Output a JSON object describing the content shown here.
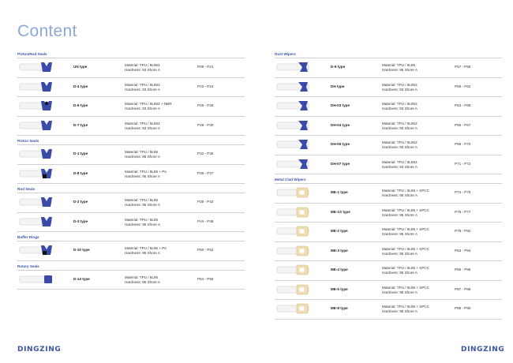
{
  "title": "Content",
  "logo": "DINGZING",
  "colors": {
    "accent": "#3b54a6",
    "title": "#8ea8d8",
    "seal_blue": "#3a4aa8",
    "metal": "#f1dfb2"
  },
  "left_column": [
    {
      "heading": "Piston/Rod Seals",
      "items": [
        {
          "icon": "un-type-seal-icon",
          "type": "UN type",
          "material": "Material: TPU / 8L953",
          "hardness": "Hardness: 93 Shore A",
          "pages": "P05 - P21"
        },
        {
          "icon": "d4-type-seal-icon",
          "type": "D-4 type",
          "material": "Material: TPU / 8L953",
          "hardness": "Hardness: 93 Shore A",
          "pages": "P22 - P24"
        },
        {
          "icon": "d6-type-seal-icon",
          "type": "D-6 type",
          "material": "Material: TPU / 8L953 + NBR",
          "hardness": "Hardness: 93 Shore A",
          "pages": "P25 - P28"
        },
        {
          "icon": "d7-type-seal-icon",
          "type": "D-7 type",
          "material": "Material: TPU / 8L953",
          "hardness": "Hardness: 93 Shore A",
          "pages": "P29 - P30"
        }
      ]
    },
    {
      "heading": "Piston Seals",
      "items": [
        {
          "icon": "d1-type-seal-icon",
          "type": "D-1 type",
          "material": "Material: TPU / 8L95",
          "hardness": "Hardness: 95 Shore A",
          "pages": "P32 - P35"
        },
        {
          "icon": "d8-type-seal-icon",
          "type": "D-8 type",
          "material": "Material: TPU / 8L95 + PA",
          "hardness": "Hardness: 95 Shore A",
          "pages": "P36 - P37"
        }
      ]
    },
    {
      "heading": "Rod Seals",
      "items": [
        {
          "icon": "d2-type-seal-icon",
          "type": "D-2 type",
          "material": "Material: TPU / 8L95",
          "hardness": "Hardness: 95 Shore A",
          "pages": "P39 - P43"
        },
        {
          "icon": "d3-type-seal-icon",
          "type": "D-3 type",
          "material": "Material: TPU / 8L95",
          "hardness": "Hardness: 95 Shore A",
          "pages": "P44 - P48"
        }
      ]
    },
    {
      "heading": "Buffer Rings",
      "items": [
        {
          "icon": "d10-type-seal-icon",
          "type": "D-10 type",
          "material": "Material: TPU / 8L95 + PA",
          "hardness": "Hardness: 95 Shore A",
          "pages": "P50 - P52"
        }
      ]
    },
    {
      "heading": "Rotary Seals",
      "items": [
        {
          "icon": "d14-type-seal-icon",
          "type": "D-14 type",
          "material": "Material: TPU / 8L95",
          "hardness": "Hardness: 95 Shore A",
          "pages": "P54 - P55"
        }
      ]
    }
  ],
  "right_column": [
    {
      "heading": "Dust Wipers",
      "items": [
        {
          "icon": "d9-type-wiper-icon",
          "type": "D-9 type",
          "material": "Material: TPU / 8L95",
          "hardness": "Hardness: 95 Shore A",
          "pages": "P57 - P58"
        },
        {
          "icon": "dh-type-wiper-icon",
          "type": "DH type",
          "material": "Material: TPU / 8L953",
          "hardness": "Hardness: 93 Shore A",
          "pages": "P59 - P62"
        },
        {
          "icon": "dh03-type-wiper-icon",
          "type": "DH-03 type",
          "material": "Material: TPU / 8L953",
          "hardness": "Hardness: 93 Shore A",
          "pages": "P63 - P65"
        },
        {
          "icon": "dh04-type-wiper-icon",
          "type": "DH-04 type",
          "material": "Material: TPU / 8L953",
          "hardness": "Hardness: 93 Shore A",
          "pages": "P66 - P67"
        },
        {
          "icon": "dh05-type-wiper-icon",
          "type": "DH-05 type",
          "material": "Material: TPU / 8L953",
          "hardness": "Hardness: 93 Shore A",
          "pages": "P68 - P70"
        },
        {
          "icon": "dh07-type-wiper-icon",
          "type": "DH-07 type",
          "material": "Material: TPU / 8L953",
          "hardness": "Hardness: 93 Shore A",
          "pages": "P71 - P72"
        }
      ]
    },
    {
      "heading": "Metal Clad Wipers",
      "items": [
        {
          "icon": "me1-type-wiper-icon",
          "type": "ME-1 type",
          "material": "Material: TPU / 8L95 + SPCC",
          "hardness": "Hardness: 95 Shore A",
          "pages": "P74 - P75"
        },
        {
          "icon": "me1s-type-wiper-icon",
          "type": "ME-1S type",
          "material": "Material: TPU / 8L95 + SPCC",
          "hardness": "Hardness: 95 Shore A",
          "pages": "P76 - P77"
        },
        {
          "icon": "me2-type-wiper-icon",
          "type": "ME-2 type",
          "material": "Material: TPU / 8L95 + SPCC",
          "hardness": "Hardness: 95 Shore A",
          "pages": "P78 - P82"
        },
        {
          "icon": "me3-type-wiper-icon",
          "type": "ME-3 type",
          "material": "Material: TPU / 8L95 + SPCC",
          "hardness": "Hardness: 95 Shore A",
          "pages": "P83 - P84"
        },
        {
          "icon": "me4-type-wiper-icon",
          "type": "ME-4 type",
          "material": "Material: TPU / 8L95 + SPCC",
          "hardness": "Hardness: 95 Shore A",
          "pages": "P85 - P86"
        },
        {
          "icon": "me5-type-wiper-icon",
          "type": "ME-5 type",
          "material": "Material: TPU / 8L95 + SPCC",
          "hardness": "Hardness: 95 Shore A",
          "pages": "P87 - P88"
        },
        {
          "icon": "me8-type-wiper-icon",
          "type": "ME-8 type",
          "material": "Material: TPU / 8L95 + SPCC",
          "hardness": "Hardness: 95 Shore A",
          "pages": "P89 - P90"
        }
      ]
    }
  ]
}
